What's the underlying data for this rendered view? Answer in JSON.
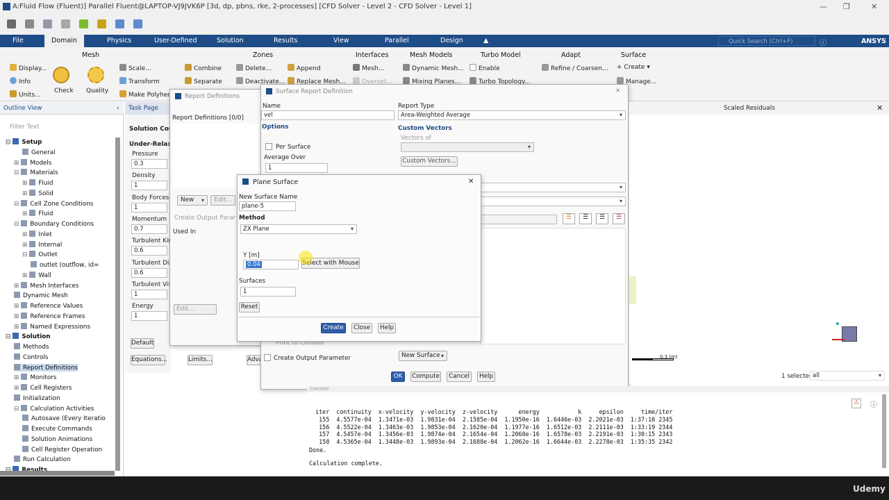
{
  "window": {
    "title": "A:Fluid Flow (Fluent)] Parallel Fluent@LAPTOP-VJ9JVK6P [3d, dp, pbns, rke, 2-processes] [CFD Solver - Level 2 - CFD Solver - Level 1]",
    "minimize": "—",
    "restore": "❐",
    "close": "✕"
  },
  "tabs": [
    "File",
    "Domain",
    "Physics",
    "User-Defined",
    "Solution",
    "Results",
    "View",
    "Parallel",
    "Design"
  ],
  "search_placeholder": "Quick Search (Ctrl+F)",
  "brand": "ANSYS",
  "ribbon": {
    "mesh": {
      "title": "Mesh",
      "display": "Display...",
      "scale": "Scale...",
      "info": "Info",
      "transform": "Transform",
      "units": "Units...",
      "check": "Check",
      "quality": "Quality",
      "make_polyhedra": "Make Polyhedra"
    },
    "zones": {
      "title": "Zones",
      "combine": "Combine",
      "delete": "Delete...",
      "append": "Append",
      "separate": "Separate",
      "deactivate": "Deactivate...",
      "replace_mesh": "Replace Mesh..."
    },
    "interfaces": {
      "title": "Interfaces",
      "mesh": "Mesh...",
      "overset": "Overset..."
    },
    "mesh_models": {
      "title": "Mesh Models",
      "dynamic_mesh": "Dynamic Mesh...",
      "mixing_planes": "Mixing Planes..."
    },
    "turbo": {
      "title": "Turbo Model",
      "enable": "Enable",
      "topology": "Turbo Topology..."
    },
    "adapt": {
      "title": "Adapt",
      "refine": "Refine / Coarsen..."
    },
    "surface": {
      "title": "Surface",
      "create": "Create",
      "manage": "Manage..."
    }
  },
  "outline": {
    "title": "Outline View",
    "filter_placeholder": "Filter Text",
    "items": [
      {
        "label": "Setup",
        "bold": true,
        "indent": 0,
        "exp": "⊟"
      },
      {
        "label": "General",
        "indent": 2
      },
      {
        "label": "Models",
        "indent": 1,
        "exp": "⊞"
      },
      {
        "label": "Materials",
        "indent": 1,
        "exp": "⊟"
      },
      {
        "label": "Fluid",
        "indent": 2,
        "exp": "⊞"
      },
      {
        "label": "Solid",
        "indent": 2,
        "exp": "⊞"
      },
      {
        "label": "Cell Zone Conditions",
        "indent": 1,
        "exp": "⊟"
      },
      {
        "label": "Fluid",
        "indent": 2,
        "exp": "⊞"
      },
      {
        "label": "Boundary Conditions",
        "indent": 1,
        "exp": "⊟"
      },
      {
        "label": "Inlet",
        "indent": 2,
        "exp": "⊞"
      },
      {
        "label": "Internal",
        "indent": 2,
        "exp": "⊞"
      },
      {
        "label": "Outlet",
        "indent": 2,
        "exp": "⊟"
      },
      {
        "label": "outlet (outflow, id=",
        "indent": 3
      },
      {
        "label": "Wall",
        "indent": 2,
        "exp": "⊞"
      },
      {
        "label": "Mesh Interfaces",
        "indent": 1,
        "exp": "⊞"
      },
      {
        "label": "Dynamic Mesh",
        "indent": 1
      },
      {
        "label": "Reference Values",
        "indent": 1,
        "exp": "⊞"
      },
      {
        "label": "Reference Frames",
        "indent": 1,
        "exp": "⊞"
      },
      {
        "label": "Named Expressions",
        "indent": 1,
        "exp": "⊞"
      },
      {
        "label": "Solution",
        "bold": true,
        "indent": 0,
        "exp": "⊟"
      },
      {
        "label": "Methods",
        "indent": 1
      },
      {
        "label": "Controls",
        "indent": 1
      },
      {
        "label": "Report Definitions",
        "indent": 1,
        "selected": true
      },
      {
        "label": "Monitors",
        "indent": 1,
        "exp": "⊞"
      },
      {
        "label": "Cell Registers",
        "indent": 1,
        "exp": "⊞"
      },
      {
        "label": "Initialization",
        "indent": 1
      },
      {
        "label": "Calculation Activities",
        "indent": 1,
        "exp": "⊟"
      },
      {
        "label": "Autosave (Every Iteratio",
        "indent": 2
      },
      {
        "label": "Execute Commands",
        "indent": 2
      },
      {
        "label": "Solution Animations",
        "indent": 2
      },
      {
        "label": "Cell Register Operation",
        "indent": 2
      },
      {
        "label": "Run Calculation",
        "indent": 1
      },
      {
        "label": "Results",
        "bold": true,
        "indent": 0,
        "exp": "⊟"
      },
      {
        "label": "Surfaces",
        "indent": 1
      }
    ]
  },
  "task_page": {
    "title": "Task Page",
    "section": "Solution Cont",
    "sub": "Under-Relaxa",
    "fields": [
      {
        "label": "Pressure",
        "value": "0.3"
      },
      {
        "label": "Density",
        "value": "1"
      },
      {
        "label": "Body Forces",
        "value": "1"
      },
      {
        "label": "Momentum",
        "value": "0.7"
      },
      {
        "label": "Turbulent Kine",
        "value": "0.6"
      },
      {
        "label": "Turbulent Diss",
        "value": "0.6"
      },
      {
        "label": "Turbulent Visc",
        "value": "1"
      },
      {
        "label": "Energy",
        "value": "1"
      }
    ],
    "default_btn": "Default",
    "equations_btn": "Equations...",
    "limits_btn": "Limits...",
    "advanced_btn": "Adva"
  },
  "report_defs": {
    "title": "Report Definitions",
    "header": "Report Definitions  [0/0]",
    "new_btn": "New",
    "edit_btn": "Edit...",
    "create_output": "Create Output Parar",
    "used_in": "Used In",
    "edit2": "Edit..."
  },
  "surface_report": {
    "title": "Surface Report Definition",
    "name_label": "Name",
    "name_value": "vel",
    "options": "Options",
    "per_surface": "Per Surface",
    "average_over": "Average Over",
    "average_value": "1",
    "report_type_label": "Report Type",
    "report_type_value": "Area-Weighted Average",
    "custom_vectors": "Custom Vectors",
    "vectors_of": "Vectors of",
    "custom_vectors_btn": "Custom Vectors...",
    "print_console": "Print to Console",
    "create_output": "Create Output Parameter",
    "new_surface": "New Surface",
    "ok": "OK",
    "compute": "Compute",
    "cancel": "Cancel",
    "help": "Help"
  },
  "plane": {
    "title": "Plane Surface",
    "new_name_label": "New Surface Name",
    "new_name_value": "plane-5",
    "method_label": "Method",
    "method_value": "ZX Plane",
    "y_label": "Y [m]",
    "y_value": "0.04",
    "select_mouse": "Select with Mouse",
    "surfaces_label": "Surfaces",
    "surfaces_value": "1",
    "reset": "Reset",
    "create": "Create",
    "close": "Close",
    "help": "Help"
  },
  "graphics": {
    "title": "Scaled Residuals",
    "scale_label": "0.3 (m)",
    "selected": "1 selected",
    "filter": "all"
  },
  "console": {
    "title": "Console",
    "header": "  iter  continuity  x-velocity  y-velocity  z-velocity      energy           k     epsilon     time/iter",
    "rows": [
      "   155  4.5577e-04  1.3471e-03  1.9831e-04  2.1585e-04  1.1950e-16  1.6446e-03  2.2021e-03  1:37:10 2345",
      "   156  4.5522e-04  1.3463e-03  1.9853e-04  2.1620e-04  1.1977e-16  1.6512e-03  2.2111e-03  1:33:19 2344",
      "   157  4.5457e-04  1.3456e-03  1.9874e-04  2.1654e-04  1.2068e-16  1.6578e-03  2.2191e-03  1:30:15 2343",
      "   158  4.5365e-04  1.3448e-03  1.9893e-04  2.1688e-04  1.2062e-16  1.6644e-03  2.2278e-03  1:35:35 2342"
    ],
    "done": "Done.",
    "complete": "Calculation complete."
  },
  "watermark": "Udemy"
}
